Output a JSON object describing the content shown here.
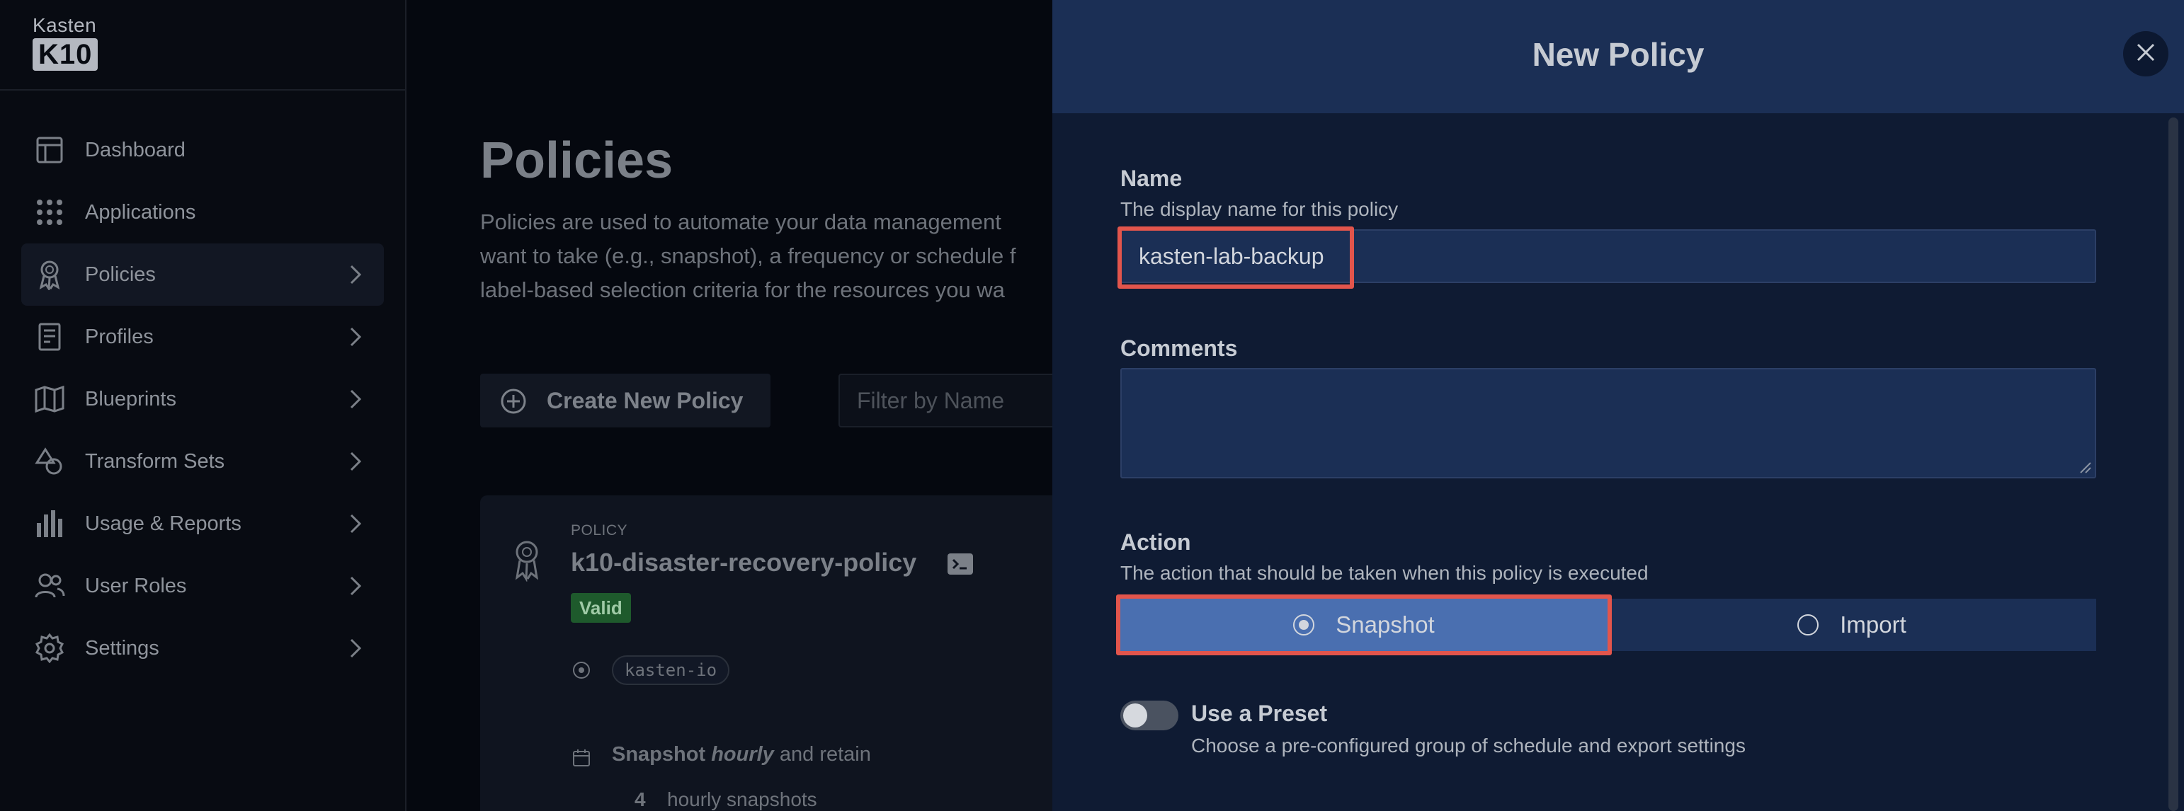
{
  "brand": {
    "top": "Kasten",
    "box": "K10"
  },
  "sidebar": {
    "items": [
      {
        "label": "Dashboard",
        "icon": "dashboard-icon",
        "chevron": false
      },
      {
        "label": "Applications",
        "icon": "applications-icon",
        "chevron": false
      },
      {
        "label": "Policies",
        "icon": "policies-icon",
        "chevron": true
      },
      {
        "label": "Profiles",
        "icon": "profiles-icon",
        "chevron": true
      },
      {
        "label": "Blueprints",
        "icon": "blueprints-icon",
        "chevron": true
      },
      {
        "label": "Transform Sets",
        "icon": "transform-sets-icon",
        "chevron": true
      },
      {
        "label": "Usage & Reports",
        "icon": "usage-reports-icon",
        "chevron": true
      },
      {
        "label": "User Roles",
        "icon": "user-roles-icon",
        "chevron": true
      },
      {
        "label": "Settings",
        "icon": "settings-icon",
        "chevron": true
      }
    ],
    "active_item": "Policies"
  },
  "main": {
    "title": "Policies",
    "description": "Policies are used to automate your data management\nwant to take (e.g., snapshot), a frequency or schedule f\nlabel-based selection criteria for the resources you wa",
    "create_button": "Create New Policy",
    "filter_placeholder": "Filter by Name",
    "policy_card": {
      "kicker": "POLICY",
      "name": "k10-disaster-recovery-policy",
      "status": "Valid",
      "namespace": "kasten-io",
      "schedule_action": "Snapshot",
      "schedule_frequency": "hourly",
      "schedule_suffix": "and retain",
      "retain_count": "4",
      "retain_label": "hourly snapshots"
    }
  },
  "modal": {
    "title": "New Policy",
    "name": {
      "label": "Name",
      "help": "The display name for this policy",
      "value": "kasten-lab-backup"
    },
    "comments": {
      "label": "Comments",
      "value": ""
    },
    "action": {
      "label": "Action",
      "help": "The action that should be taken when this policy is executed",
      "options": [
        "Snapshot",
        "Import"
      ],
      "selected": "Snapshot"
    },
    "preset": {
      "label": "Use a Preset",
      "help": "Choose a pre-configured group of schedule and export settings",
      "enabled": false
    }
  },
  "colors": {
    "modal_header": "#1b2f55",
    "modal_body": "#0f1b33",
    "selected_option": "#4a6fb0",
    "highlight": "#e2554c",
    "valid_badge": "#1e5a2c"
  }
}
